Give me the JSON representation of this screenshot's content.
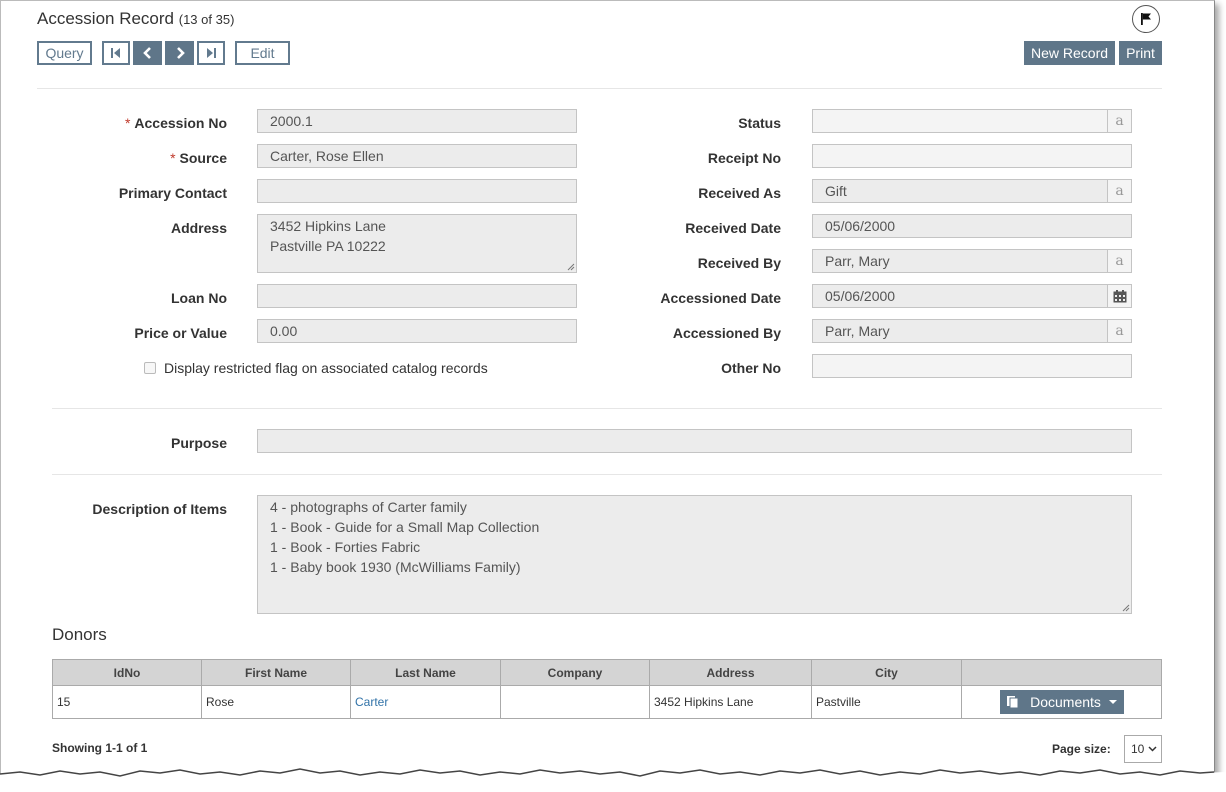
{
  "header": {
    "title": "Accession Record",
    "count": "(13 of 35)"
  },
  "toolbar": {
    "query_label": "Query",
    "edit_label": "Edit",
    "new_record_label": "New Record",
    "print_label": "Print"
  },
  "form": {
    "accession_no": {
      "label": "Accession No",
      "value": "2000.1"
    },
    "source": {
      "label": "Source",
      "value": "Carter, Rose Ellen"
    },
    "primary_contact": {
      "label": "Primary Contact",
      "value": ""
    },
    "address": {
      "label": "Address",
      "line1": "3452 Hipkins Lane",
      "line2": "Pastville PA 10222"
    },
    "loan_no": {
      "label": "Loan No",
      "value": ""
    },
    "price_or_value": {
      "label": "Price or Value",
      "value": "0.00"
    },
    "restricted_flag_label": "Display restricted flag on associated catalog records",
    "status": {
      "label": "Status",
      "value": ""
    },
    "receipt_no": {
      "label": "Receipt No",
      "value": ""
    },
    "received_as": {
      "label": "Received As",
      "value": "Gift"
    },
    "received_date": {
      "label": "Received Date",
      "value": "05/06/2000"
    },
    "received_by": {
      "label": "Received By",
      "value": "Parr, Mary"
    },
    "accessioned_date": {
      "label": "Accessioned Date",
      "value": "05/06/2000"
    },
    "accessioned_by": {
      "label": "Accessioned By",
      "value": "Parr, Mary"
    },
    "other_no": {
      "label": "Other No",
      "value": ""
    },
    "purpose": {
      "label": "Purpose",
      "value": ""
    },
    "description": {
      "label": "Description of Items",
      "lines": [
        "4 - photographs of Carter family",
        "1 - Book - Guide for a Small Map Collection",
        "1 - Book - Forties Fabric",
        "1 - Baby book 1930 (McWilliams Family)"
      ]
    },
    "addon_glyph": "a"
  },
  "donors": {
    "title": "Donors",
    "columns": [
      "IdNo",
      "First Name",
      "Last Name",
      "Company",
      "Address",
      "City",
      ""
    ],
    "rows": [
      {
        "idno": "15",
        "first": "Rose",
        "last": "Carter",
        "company": "",
        "address": "3452 Hipkins Lane",
        "city": "Pastville",
        "action": "Documents"
      }
    ],
    "showing": "Showing 1-1 of 1",
    "page_size_label": "Page size:",
    "page_size_value": "10"
  },
  "colors": {
    "accent": "#5f7689",
    "required": "#c0392b",
    "link": "#3273a8"
  },
  "icons": [
    "flag-icon",
    "first-record-icon",
    "previous-record-icon",
    "next-record-icon",
    "last-record-icon",
    "lookup-icon",
    "calendar-icon",
    "documents-icon",
    "caret-down-icon",
    "chevron-down-icon"
  ]
}
